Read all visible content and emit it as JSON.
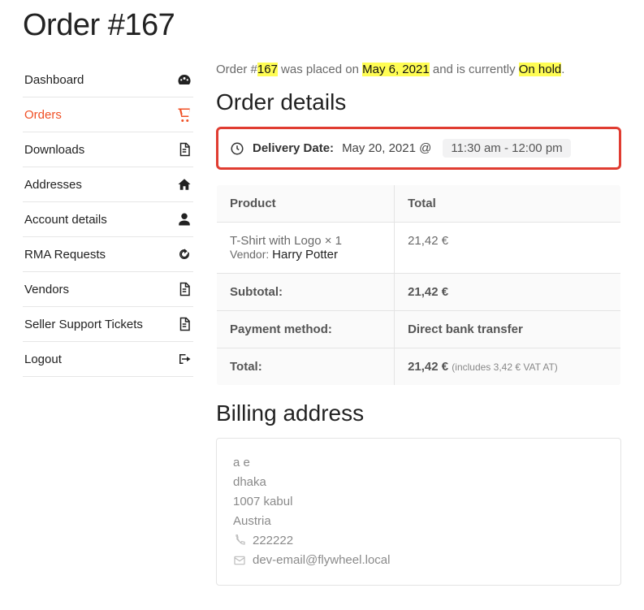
{
  "page_title": "Order #167",
  "sidebar": {
    "items": [
      {
        "label": "Dashboard",
        "icon": "gauge-icon",
        "active": false
      },
      {
        "label": "Orders",
        "icon": "cart-icon",
        "active": true
      },
      {
        "label": "Downloads",
        "icon": "file-icon",
        "active": false
      },
      {
        "label": "Addresses",
        "icon": "home-icon",
        "active": false
      },
      {
        "label": "Account details",
        "icon": "user-icon",
        "active": false
      },
      {
        "label": "RMA Requests",
        "icon": "refresh-icon",
        "active": false
      },
      {
        "label": "Vendors",
        "icon": "file-icon",
        "active": false
      },
      {
        "label": "Seller Support Tickets",
        "icon": "file-icon",
        "active": false
      },
      {
        "label": "Logout",
        "icon": "logout-icon",
        "active": false
      }
    ]
  },
  "status": {
    "prefix": "Order #",
    "order_num": "167",
    "mid1": " was placed on ",
    "placed_date": "May 6, 2021",
    "mid2": " and is currently ",
    "state": "On hold",
    "suffix": "."
  },
  "order_details_heading": "Order details",
  "delivery": {
    "label": "Delivery Date:",
    "date": "May 20, 2021 @",
    "time": "11:30 am - 12:00 pm"
  },
  "table": {
    "head_product": "Product",
    "head_total": "Total",
    "product_name": "T-Shirt with Logo ",
    "qty": "× 1",
    "vendor_label": "Vendor: ",
    "vendor_name": "Harry Potter",
    "line_total": "21,42 €",
    "subtotal_label": "Subtotal:",
    "subtotal_value": "21,42 €",
    "payment_label": "Payment method:",
    "payment_value": "Direct bank transfer",
    "total_label": "Total:",
    "total_value": "21,42 € ",
    "vat_note": "(includes 3,42 € VAT AT)"
  },
  "billing_heading": "Billing address",
  "billing": {
    "name": "a e",
    "street": "dhaka",
    "city": "1007 kabul",
    "country": "Austria",
    "phone": "222222",
    "email": "dev-email@flywheel.local"
  }
}
